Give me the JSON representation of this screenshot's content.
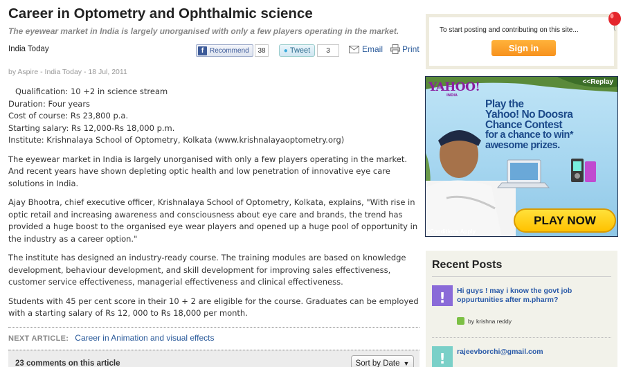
{
  "article": {
    "title": "Career in Optometry and Ophthalmic science",
    "subtitle": "The eyewear market in India is largely unorganised with only a few players operating in the market.",
    "source": "India Today",
    "byline": "by Aspire - India Today - 18 Jul, 2011",
    "facts": [
      "Qualification: 10 +2 in science stream",
      "Duration: Four years",
      "Cost of course: Rs 23,800 p.a.",
      "Starting salary: Rs 12,000-Rs 18,000 p.m.",
      "Institute: Krishnalaya School of Optometry, Kolkata (www.krishnalayaoptometry.org)"
    ],
    "paragraphs": [
      "The eyewear market in India is largely unorganised with only a few players operating in the market. And recent years have shown depleting optic health and low penetration of innovative eye care solutions in India.",
      "Ajay Bhootra, chief executive officer, Krishnalaya School of Optometry, Kolkata, explains, \"With rise in optic retail and increasing awareness and consciousness about eye care and brands, the trend has provided a huge boost to the organised eye wear players and opened up a huge pool of opportunity in the industry as a career option.\"",
      "The institute has designed an industry-ready course. The training modules are based on knowledge development, behaviour development, and skill development for improving sales effectiveness, customer service effectiveness, managerial effectiveness and clinical effectiveness.",
      "Students with 45 per cent score in their 10 + 2 are eligible for the course. Graduates can be employed with a starting salary of Rs 12, 000 to Rs 18,000 per month."
    ]
  },
  "share": {
    "facebook_label": "Recommend",
    "facebook_count": "38",
    "twitter_label": "Tweet",
    "twitter_count": "3",
    "email_label": "Email",
    "print_label": "Print"
  },
  "next_article": {
    "label": "NEXT ARTICLE:",
    "title": "Career in Animation and visual effects"
  },
  "comments": {
    "count_label": "23 comments on this article",
    "sort_label": "Sort by Date"
  },
  "signin": {
    "text": "To start posting and contributing on this site...",
    "button": "Sign in"
  },
  "ad": {
    "logo": "YAHOO!",
    "logo_sub": "INDIA",
    "replay": "<<Replay",
    "headline_line1": "Play the",
    "headline_line2": "Yahoo! No Doosra",
    "headline_line3": "Chance Contest",
    "headline_line4": "for a chance to win*",
    "headline_line5": "awesome prizes.",
    "cta": "PLAY NOW",
    "conditions": "*Conditions Apply"
  },
  "recent_posts": {
    "title": "Recent Posts",
    "items": [
      {
        "title": "Hi guys ! may i know the govt job oppurtunities after m.pharm?",
        "by": "by",
        "author": "krishna reddy",
        "avatar_char": "!"
      },
      {
        "title": "rajeevborchi@gmail.com",
        "avatar_char": "!"
      }
    ]
  },
  "colors": {
    "link": "#2a5a9a",
    "signin_orange": "#f7921e",
    "sidebar_bg": "#f2f2ea"
  }
}
